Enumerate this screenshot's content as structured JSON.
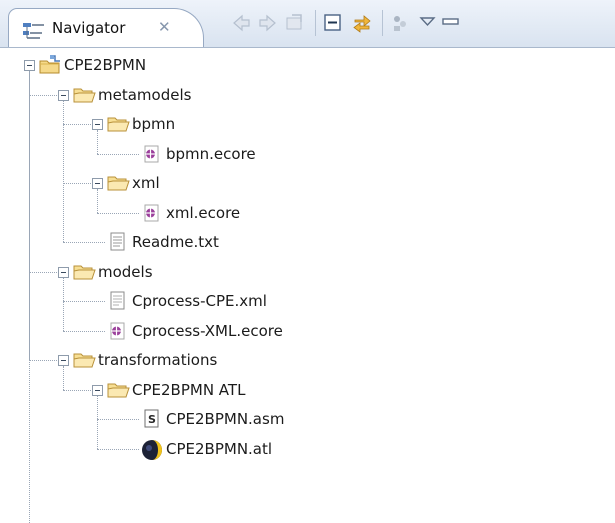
{
  "view": {
    "tab_label": "Navigator",
    "tab_close": "✕",
    "tab_icon": "navigator-view-icon"
  },
  "toolbar": {
    "buttons": [
      {
        "name": "back-icon",
        "enabled": false
      },
      {
        "name": "forward-icon",
        "enabled": false
      },
      {
        "name": "go-into-icon",
        "enabled": false
      },
      {
        "name": "collapse-all-icon",
        "enabled": true
      },
      {
        "name": "link-with-editor-icon",
        "enabled": true
      },
      {
        "name": "filters-icon",
        "enabled": true
      },
      {
        "name": "view-menu-icon",
        "enabled": true
      },
      {
        "name": "minimize-icon",
        "enabled": true
      }
    ]
  },
  "tree": [
    {
      "label": "CPE2BPMN",
      "type": "project",
      "depth": 0,
      "expanded": true
    },
    {
      "label": "metamodels",
      "type": "folder",
      "depth": 1,
      "expanded": true
    },
    {
      "label": "bpmn",
      "type": "folder",
      "depth": 2,
      "expanded": true
    },
    {
      "label": "bpmn.ecore",
      "type": "ecore",
      "depth": 3
    },
    {
      "label": "xml",
      "type": "folder",
      "depth": 2,
      "expanded": true
    },
    {
      "label": "xml.ecore",
      "type": "ecore",
      "depth": 3
    },
    {
      "label": "Readme.txt",
      "type": "text",
      "depth": 2
    },
    {
      "label": "models",
      "type": "folder",
      "depth": 1,
      "expanded": true
    },
    {
      "label": "Cprocess-CPE.xml",
      "type": "xml",
      "depth": 2
    },
    {
      "label": "Cprocess-XML.ecore",
      "type": "ecore",
      "depth": 2
    },
    {
      "label": "transformations",
      "type": "folder",
      "depth": 1,
      "expanded": true
    },
    {
      "label": "CPE2BPMN ATL",
      "type": "folder",
      "depth": 2,
      "expanded": true
    },
    {
      "label": "CPE2BPMN.asm",
      "type": "asm",
      "depth": 3
    },
    {
      "label": "CPE2BPMN.atl",
      "type": "atl",
      "depth": 3
    }
  ]
}
